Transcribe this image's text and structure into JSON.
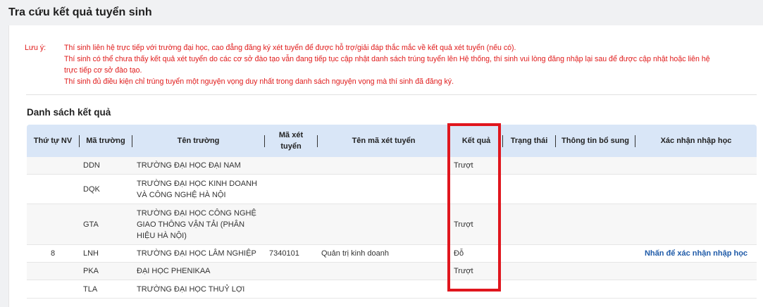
{
  "page": {
    "title": "Tra cứu kết quả tuyển sinh"
  },
  "notes": {
    "label": "Lưu ý:",
    "lines": [
      "Thí sinh liên hệ trực tiếp với trường đại học, cao đẳng đăng ký xét tuyển để được hỗ trợ/giải đáp thắc mắc về kết quả xét tuyển (nếu có).",
      "Thí sinh có thể chưa thấy kết quả xét tuyển do các cơ sở đào tạo vẫn đang tiếp tục cập nhật danh sách trúng tuyển lên Hệ thống, thí sinh vui lòng đăng nhập lại sau để được cập nhật hoặc liên hệ",
      "trực tiếp cơ sở đào tạo.",
      "Thí sinh đủ điều kiện chỉ trúng tuyển một nguyện vọng duy nhất trong danh sách nguyện vọng mà thí sinh đã đăng ký."
    ]
  },
  "results": {
    "title": "Danh sách kết quả",
    "columns": {
      "order": "Thứ tự NV",
      "school_code": "Mã trường",
      "school_name": "Tên trường",
      "admission_code": "Mã xét tuyển",
      "admission_name": "Tên mã xét tuyển",
      "result": "Kết quả",
      "status": "Trạng thái",
      "extra_info": "Thông tin bổ sung",
      "confirm": "Xác nhận nhập học"
    },
    "rows": [
      {
        "order": "",
        "school_code": "DDN",
        "school_name": "TRƯỜNG ĐẠI HỌC ĐẠI NAM",
        "admission_code": "",
        "admission_name": "",
        "result": "Trượt",
        "status": "",
        "extra_info": "",
        "confirm": ""
      },
      {
        "order": "",
        "school_code": "DQK",
        "school_name": "TRƯỜNG ĐẠI HỌC KINH DOANH VÀ CÔNG NGHỆ HÀ NỘI",
        "admission_code": "",
        "admission_name": "",
        "result": "",
        "status": "",
        "extra_info": "",
        "confirm": ""
      },
      {
        "order": "",
        "school_code": "GTA",
        "school_name": "TRƯỜNG ĐẠI HỌC CÔNG NGHỆ GIAO THÔNG VẬN TẢI (PHÂN HIỆU HÀ NỘI)",
        "admission_code": "",
        "admission_name": "",
        "result": "Trượt",
        "status": "",
        "extra_info": "",
        "confirm": ""
      },
      {
        "order": "8",
        "school_code": "LNH",
        "school_name": "TRƯỜNG ĐẠI HỌC LÂM NGHIỆP",
        "admission_code": "7340101",
        "admission_name": "Quản trị kinh doanh",
        "result": "Đỗ",
        "status": "",
        "extra_info": "",
        "confirm": "Nhấn để xác nhận nhập học"
      },
      {
        "order": "",
        "school_code": "PKA",
        "school_name": "ĐẠI HỌC PHENIKAA",
        "admission_code": "",
        "admission_name": "",
        "result": "Trượt",
        "status": "",
        "extra_info": "",
        "confirm": ""
      },
      {
        "order": "",
        "school_code": "TLA",
        "school_name": "TRƯỜNG ĐẠI HỌC THUỶ LỢI",
        "admission_code": "",
        "admission_name": "",
        "result": "",
        "status": "",
        "extra_info": "",
        "confirm": ""
      }
    ]
  },
  "colors": {
    "note_red": "#e01a1a",
    "header_bg": "#d9e6f7",
    "link_blue": "#1e5aa8",
    "highlight_red": "#e0161e"
  }
}
